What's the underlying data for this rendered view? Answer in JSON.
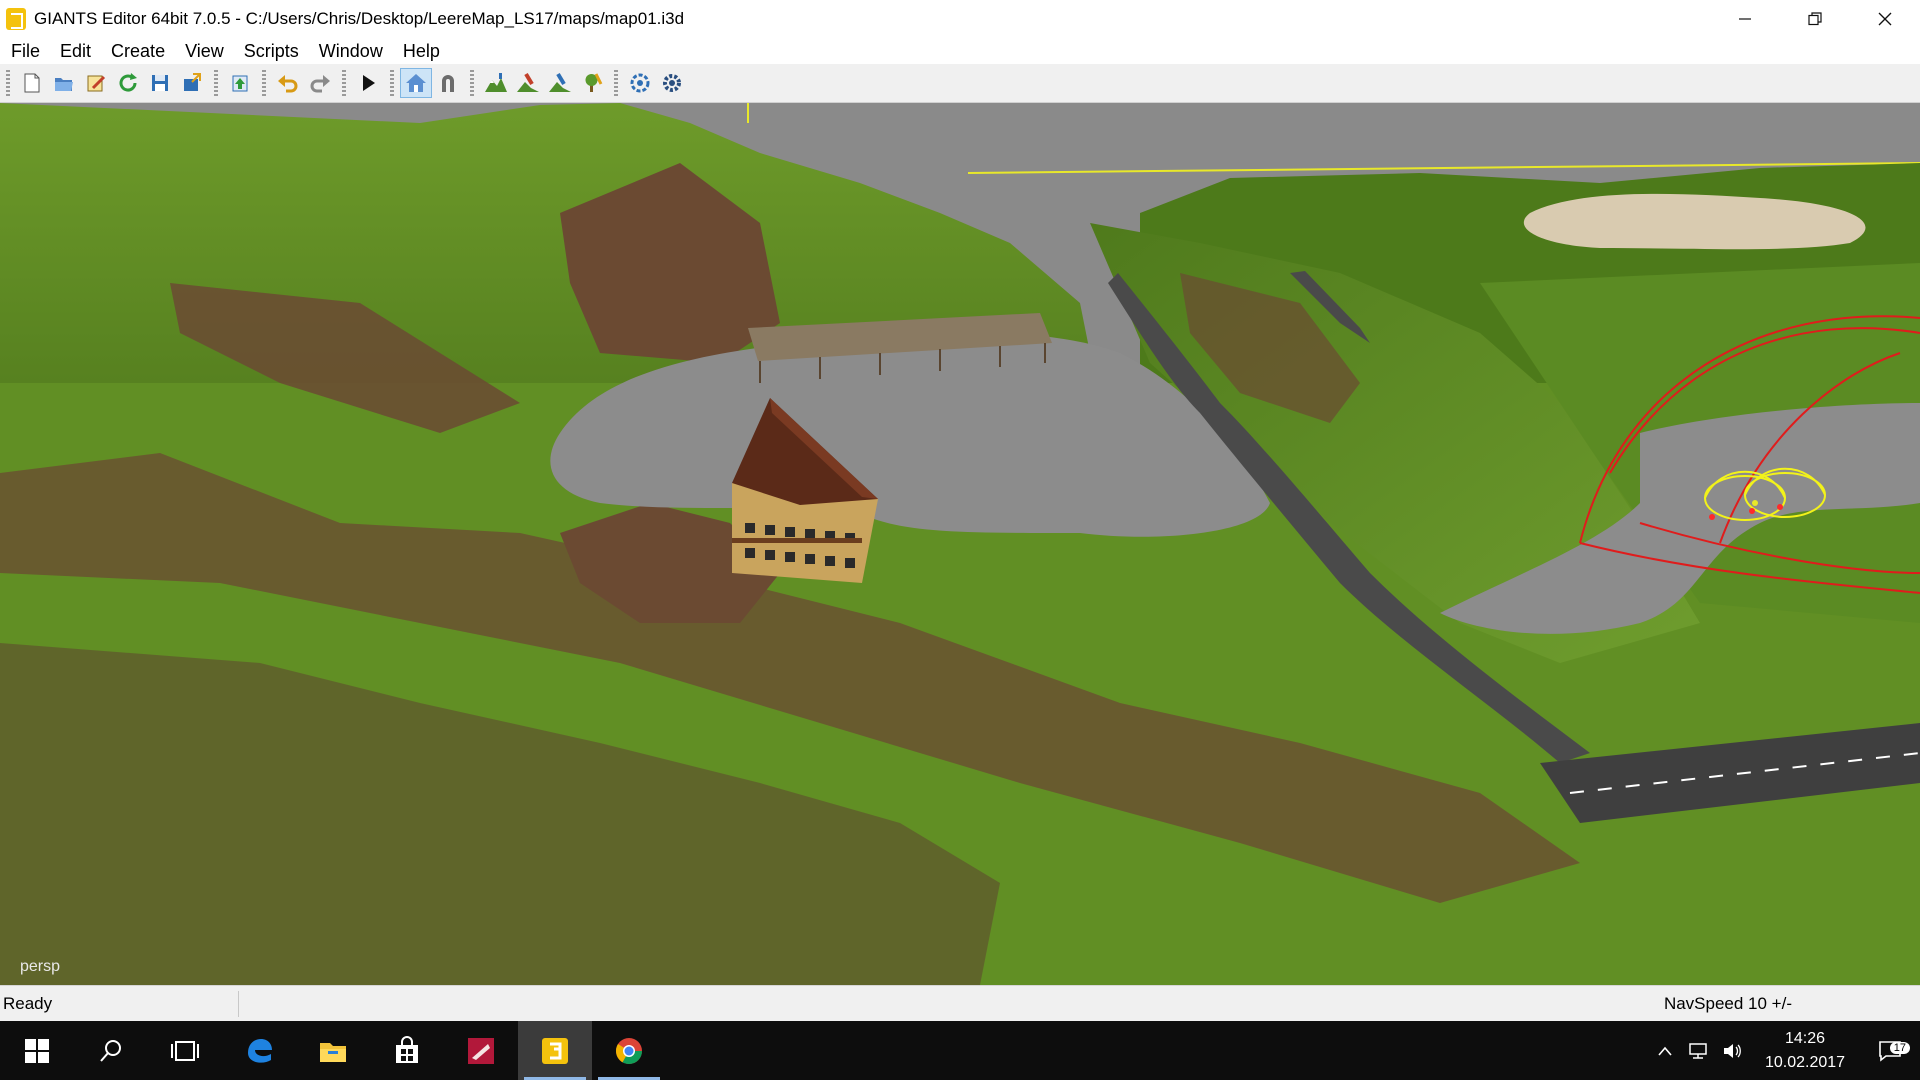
{
  "window": {
    "title": "GIANTS Editor 64bit 7.0.5 - C:/Users/Chris/Desktop/LeereMap_LS17/maps/map01.i3d"
  },
  "menu": [
    {
      "label": "File"
    },
    {
      "label": "Edit"
    },
    {
      "label": "Create"
    },
    {
      "label": "View"
    },
    {
      "label": "Scripts"
    },
    {
      "label": "Window"
    },
    {
      "label": "Help"
    }
  ],
  "toolbar": {
    "icons": [
      "new-file-icon",
      "open-file-icon",
      "edit-file-icon",
      "reload-icon",
      "save-icon",
      "export-icon",
      "import-icon",
      "undo-icon",
      "redo-icon",
      "play-icon",
      "home-icon",
      "magnet-icon",
      "terrain-sculpt-icon",
      "terrain-paint-icon",
      "foliage-paint-icon",
      "decoration-paint-icon",
      "refresh-scripts-icon",
      "gear-icon"
    ]
  },
  "viewport": {
    "camera_label": "persp"
  },
  "status": {
    "left": "Ready",
    "right": "NavSpeed 10 +/-"
  },
  "taskbar": {
    "time": "14:26",
    "date": "10.02.2017",
    "notifications": "17"
  },
  "colors": {
    "grass": "#5f8a23",
    "dirt": "#6b4a32",
    "gravel": "#8c8c8c",
    "sky": "#8a8a8a",
    "taskbar": "#0d0d0d",
    "toolbar": "#f0f0f0"
  }
}
